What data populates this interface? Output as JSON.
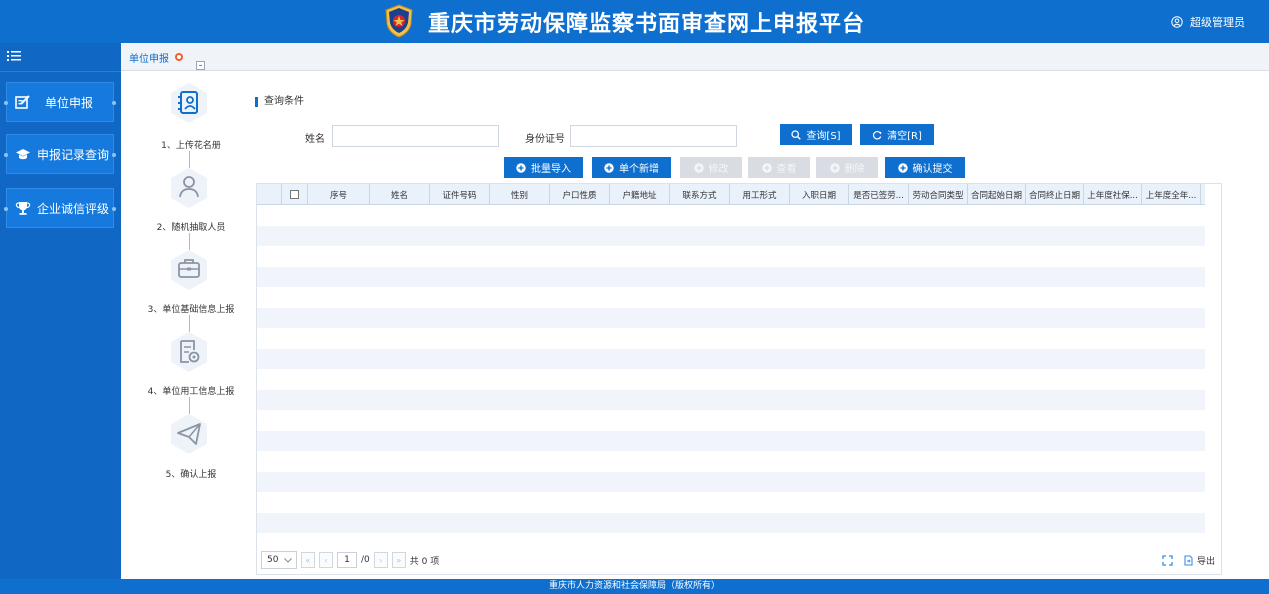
{
  "header": {
    "title": "重庆市劳动保障监察书面审查网上申报平台",
    "user": "超级管理员"
  },
  "sidebar": {
    "items": [
      {
        "label": "单位申报",
        "icon": "edit-icon"
      },
      {
        "label": "申报记录查询",
        "icon": "graduation-cap-icon"
      },
      {
        "label": "企业诚信评级",
        "icon": "trophy-icon"
      }
    ]
  },
  "tabs": [
    {
      "label": "单位申报"
    }
  ],
  "steps": [
    {
      "label": "1、上传花名册",
      "icon": "contacts-book-icon"
    },
    {
      "label": "2、随机抽取人员",
      "icon": "user-icon"
    },
    {
      "label": "3、单位基础信息上报",
      "icon": "briefcase-icon"
    },
    {
      "label": "4、单位用工信息上报",
      "icon": "document-settings-icon"
    },
    {
      "label": "5、确认上报",
      "icon": "paper-plane-icon"
    }
  ],
  "query": {
    "title": "查询条件",
    "name_label": "姓名",
    "name_value": "",
    "id_label": "身份证号",
    "id_value": "",
    "search_button": "查询[S]",
    "clear_button": "清空[R]"
  },
  "toolbar": {
    "batch_import": "批量导入",
    "add_single": "单个新增",
    "edit": "修改",
    "view": "查看",
    "delete": "删除",
    "confirm_submit": "确认提交"
  },
  "table": {
    "columns": [
      "序号",
      "姓名",
      "证件号码",
      "性别",
      "户口性质",
      "户籍地址",
      "联系方式",
      "用工形式",
      "入职日期",
      "是否已签劳...",
      "劳动合同类型",
      "合同起始日期",
      "合同终止日期",
      "上年度社保...",
      "上年度全年..."
    ],
    "rows": []
  },
  "pager": {
    "page_size": "50",
    "current_page": "1",
    "total_pages": "/0",
    "total_text": "共 0 项",
    "export_label": "导出"
  },
  "footer": {
    "text": "重庆市人力资源和社会保障局（版权所有）"
  },
  "colors": {
    "primary": "#0e6fcf",
    "sidebar": "#1067c4",
    "disabled": "#d9dde3",
    "grid_header": "#e9f1fb"
  }
}
